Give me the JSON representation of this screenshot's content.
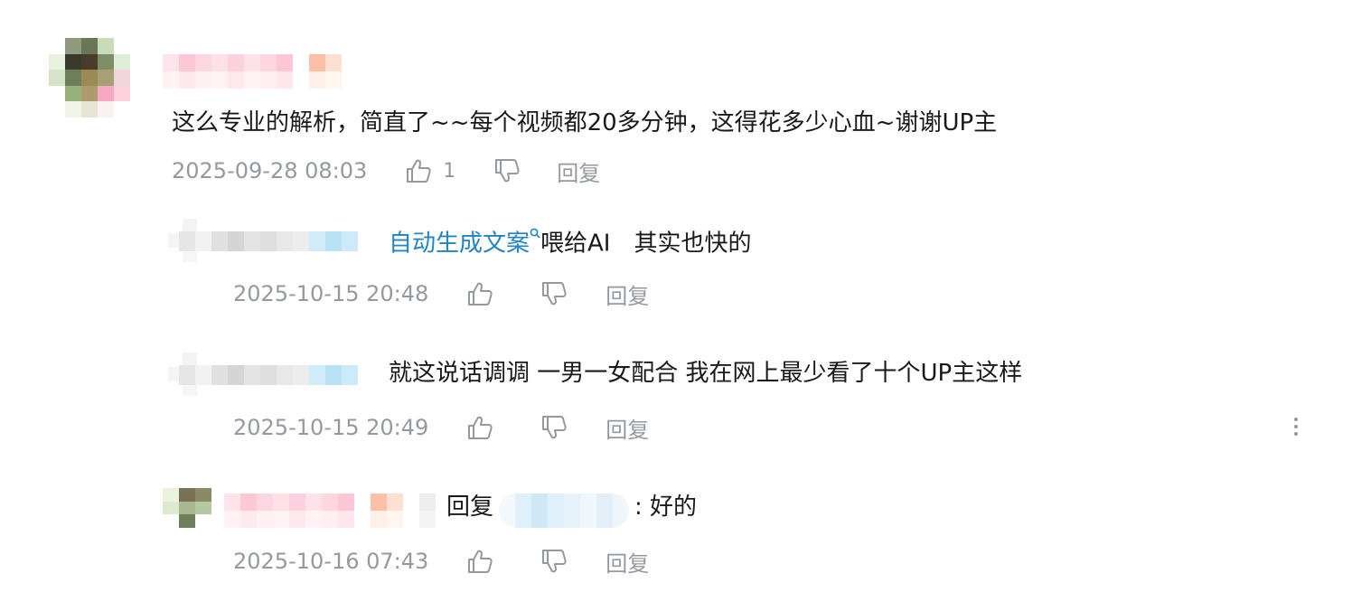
{
  "comments": {
    "main": {
      "text": "这么专业的解析，简直了~~每个视频都20多分钟，这得花多少心血~谢谢UP主",
      "time": "2025-09-28 08:03",
      "likes": "1",
      "reply_label": "回复"
    },
    "replies": [
      {
        "keyword": "自动生成文案",
        "text_after": "喂给AI　其实也快的",
        "time": "2025-10-15 20:48",
        "reply_label": "回复"
      },
      {
        "text": "就这说话调调 一男一女配合 我在网上最少看了十个UP主这样",
        "time": "2025-10-15 20:49",
        "reply_label": "回复"
      },
      {
        "reply_prefix": "回复",
        "reply_suffix": ": 好的",
        "time": "2025-10-16 07:43",
        "reply_label": "回复"
      }
    ]
  },
  "icons": {
    "like": "thumbs-up-icon",
    "dislike": "thumbs-down-icon",
    "keyword_search": "search-icon",
    "more": "more-vertical-icon"
  },
  "colors": {
    "text": "#18191c",
    "meta": "#9499a0",
    "link": "#2184c6"
  }
}
